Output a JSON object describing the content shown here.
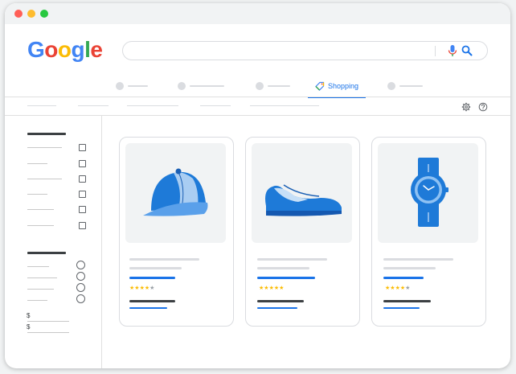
{
  "window": {
    "traffic_lights": [
      {
        "name": "close",
        "color": "#ff5f57"
      },
      {
        "name": "minimize",
        "color": "#febc2e"
      },
      {
        "name": "maximize",
        "color": "#28c840"
      }
    ]
  },
  "logo": {
    "letters": [
      {
        "char": "G",
        "color": "#4285f4"
      },
      {
        "char": "o",
        "color": "#ea4335"
      },
      {
        "char": "o",
        "color": "#fbbc05"
      },
      {
        "char": "g",
        "color": "#4285f4"
      },
      {
        "char": "l",
        "color": "#34a853"
      },
      {
        "char": "e",
        "color": "#ea4335"
      }
    ]
  },
  "search": {
    "placeholder": "",
    "value": "",
    "icons": [
      "mic-icon",
      "search-icon"
    ]
  },
  "tabs": {
    "shopping_label": "Shopping",
    "active": "Shopping",
    "accent": "#1a73e8"
  },
  "toolbar": {
    "icons": [
      "gear-icon",
      "help-icon"
    ]
  },
  "products": [
    {
      "icon": "cap-icon",
      "rating": 4,
      "max_rating": 5
    },
    {
      "icon": "sneaker-icon",
      "rating": 5,
      "max_rating": 5
    },
    {
      "icon": "watch-icon",
      "rating": 4,
      "max_rating": 5
    }
  ],
  "price_filter": {
    "min_prefix": "$",
    "max_prefix": "$"
  },
  "colors": {
    "brand_blue": "#1a73e8",
    "star": "#fbbc04",
    "placeholder": "#dadce0"
  }
}
